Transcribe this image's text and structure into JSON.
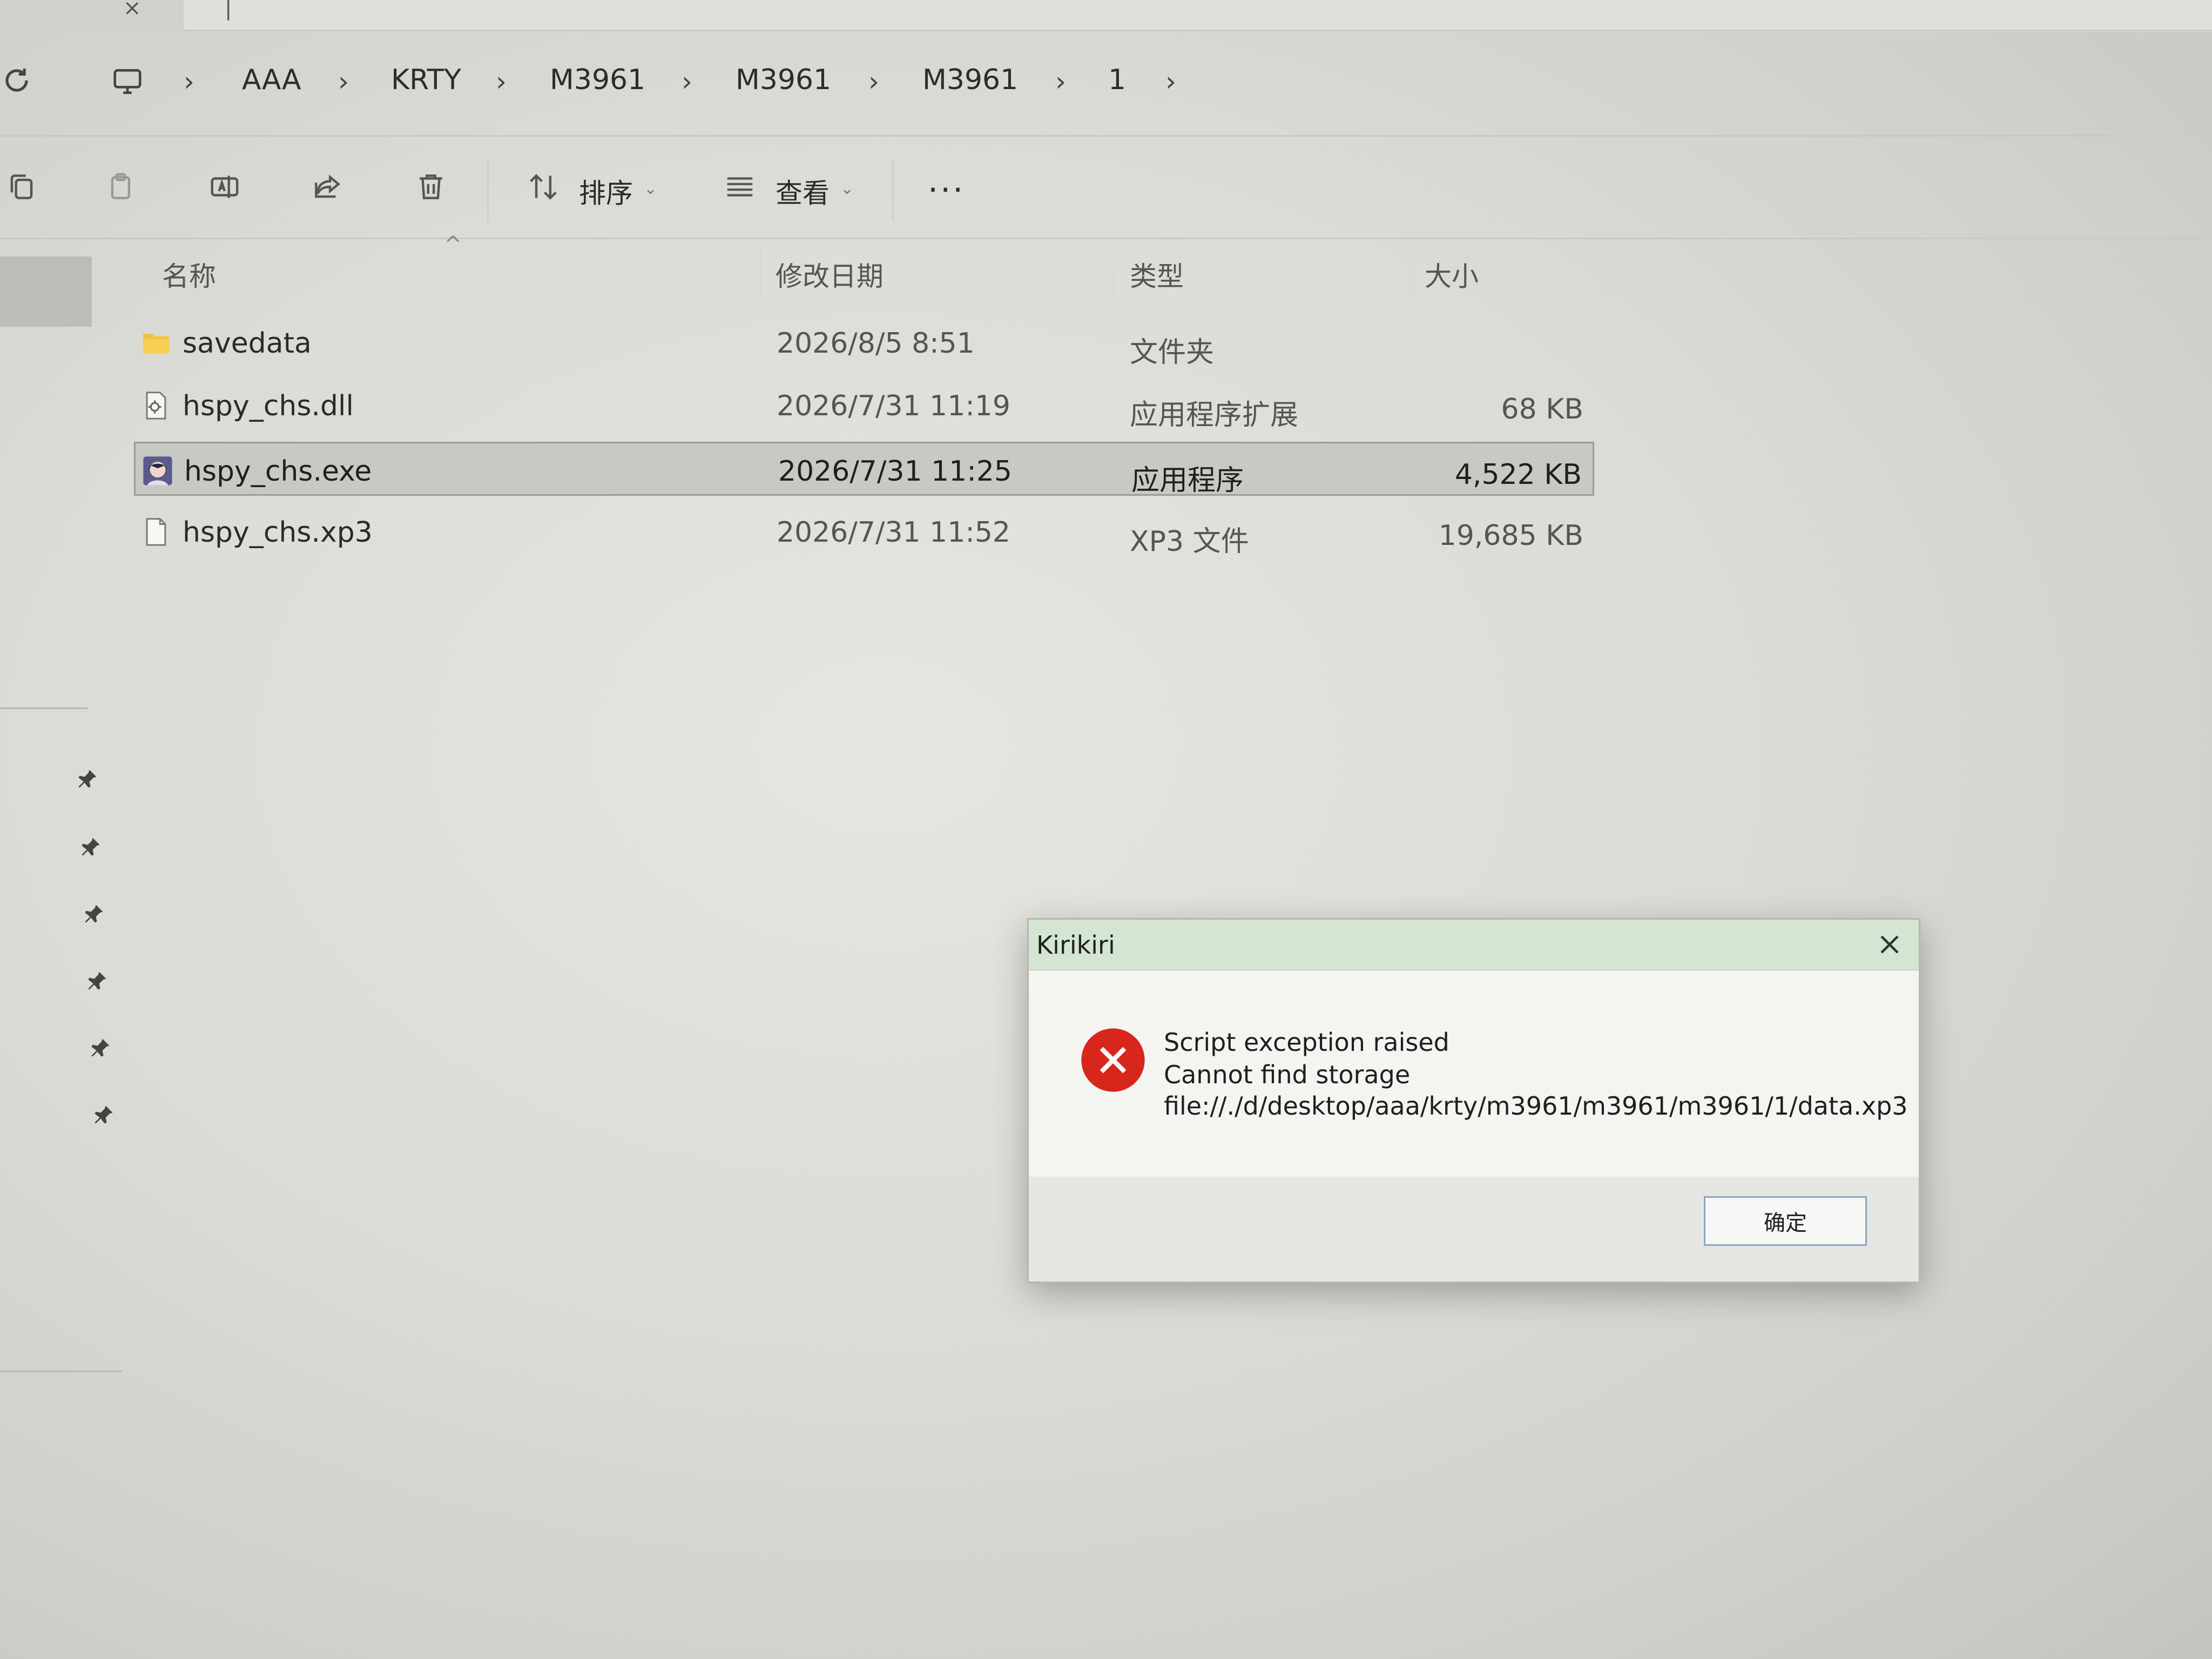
{
  "address_bar": {
    "items": [
      "AAA",
      "KRTY",
      "M3961",
      "M3961",
      "M3961",
      "1"
    ]
  },
  "toolbar": {
    "sort_label": "排序",
    "view_label": "查看",
    "more_label": "..."
  },
  "columns": {
    "name": "名称",
    "date": "修改日期",
    "type": "类型",
    "size": "大小"
  },
  "files": [
    {
      "name": "savedata",
      "date": "2026/8/5 8:51",
      "type": "文件夹",
      "size": "",
      "icon": "folder-icon"
    },
    {
      "name": "hspy_chs.dll",
      "date": "2026/7/31 11:19",
      "type": "应用程序扩展",
      "size": "68 KB",
      "icon": "dll-file-icon"
    },
    {
      "name": "hspy_chs.exe",
      "date": "2026/7/31 11:25",
      "type": "应用程序",
      "size": "4,522 KB",
      "icon": "exe-app-icon"
    },
    {
      "name": "hspy_chs.xp3",
      "date": "2026/7/31 11:52",
      "type": "XP3 文件",
      "size": "19,685 KB",
      "icon": "blank-file-icon"
    }
  ],
  "selected_row": 2,
  "dialog": {
    "title": "Kirikiri",
    "line1": "Script exception raised",
    "line2": "Cannot find storage",
    "line3": "file://./d/desktop/aaa/krty/m3961/m3961/m3961/1/data.xp3",
    "ok_label": "确定"
  },
  "colors": {
    "dialog_title_bg": "#d4e6d3",
    "error_red": "#d9261c",
    "folder_yellow": "#f2c13d"
  }
}
